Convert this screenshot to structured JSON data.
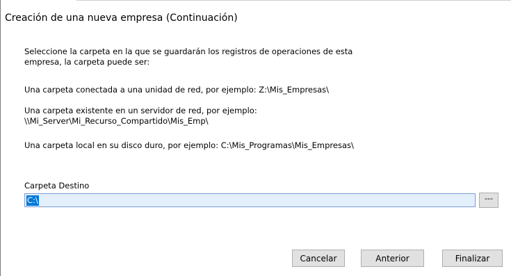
{
  "dialog": {
    "title": "Creación de una nueva empresa (Continuación)"
  },
  "instructions": {
    "intro_line1": "Seleccione la carpeta en la que se guardarán los registros de operaciones de esta",
    "intro_line2": "empresa, la carpeta puede ser:",
    "network_drive": "Una carpeta conectada a una unidad de red, por ejemplo: Z:\\Mis_Empresas\\",
    "server_line1": "Una carpeta existente en un servidor de red, por ejemplo:",
    "server_line2": "\\\\Mi_Server\\Mi_Recurso_Compartido\\Mis_Emp\\",
    "local_disk": "Una carpeta local en su disco duro, por ejemplo: C:\\Mis_Programas\\Mis_Empresas\\"
  },
  "destination": {
    "label": "Carpeta Destino",
    "value": "C:\\",
    "browse_label": "---"
  },
  "buttons": {
    "cancel": "Cancelar",
    "previous": "Anterior",
    "finish": "Finalizar"
  }
}
